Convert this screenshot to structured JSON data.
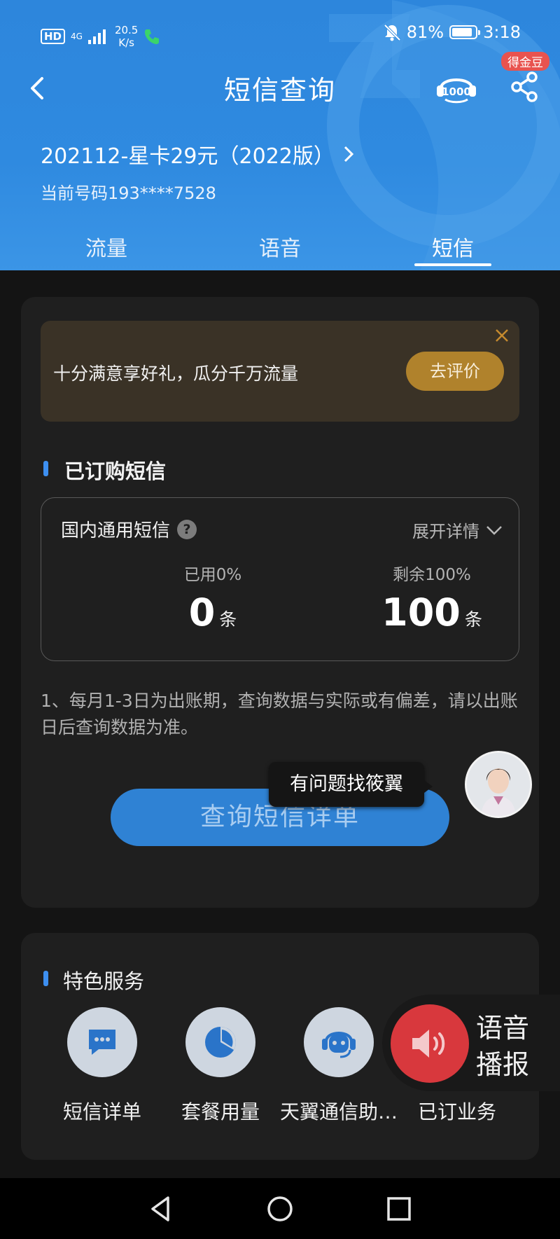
{
  "status_bar": {
    "hd": "HD",
    "network": "4G",
    "speed_value": "20.5",
    "speed_unit": "K/s",
    "battery": "81%",
    "time": "3:18"
  },
  "header": {
    "title": "短信查询",
    "badge": "得金豆",
    "plan_name": "202112-星卡29元（2022版）",
    "phone": "当前号码193****7528"
  },
  "tabs": [
    {
      "label": "流量"
    },
    {
      "label": "语音"
    },
    {
      "label": "短信"
    }
  ],
  "active_tab": "短信",
  "banner": {
    "text": "十分满意享好礼，瓜分千万流量",
    "button": "去评价"
  },
  "subscribed": {
    "title": "已订购短信",
    "item_name": "国内通用短信",
    "help": "?",
    "expand": "展开详情",
    "used_label": "已用0%",
    "used_value": "0",
    "used_unit": "条",
    "remaining_label": "剩余100%",
    "remaining_value": "100",
    "remaining_unit": "条"
  },
  "note": "1、每月1-3日为出账期，查询数据与实际或有偏差，请以出账日后查询数据为准。",
  "query_button": "查询短信详单",
  "assistant_tooltip": "有问题找筱翼",
  "features": {
    "title": "特色服务",
    "items": [
      {
        "label": "短信详单",
        "icon": "message-icon"
      },
      {
        "label": "套餐用量",
        "icon": "pie-chart-icon"
      },
      {
        "label": "天翼通信助…",
        "icon": "robot-icon"
      },
      {
        "label": "已订业务",
        "icon": "list-icon"
      }
    ]
  },
  "voice_broadcast": {
    "line1": "语音",
    "line2": "播报"
  },
  "colors": {
    "header_blue": "#2f8ae0",
    "accent_gold": "#b0822c",
    "voice_red": "#d8383d",
    "badge_red": "#e8534f"
  }
}
